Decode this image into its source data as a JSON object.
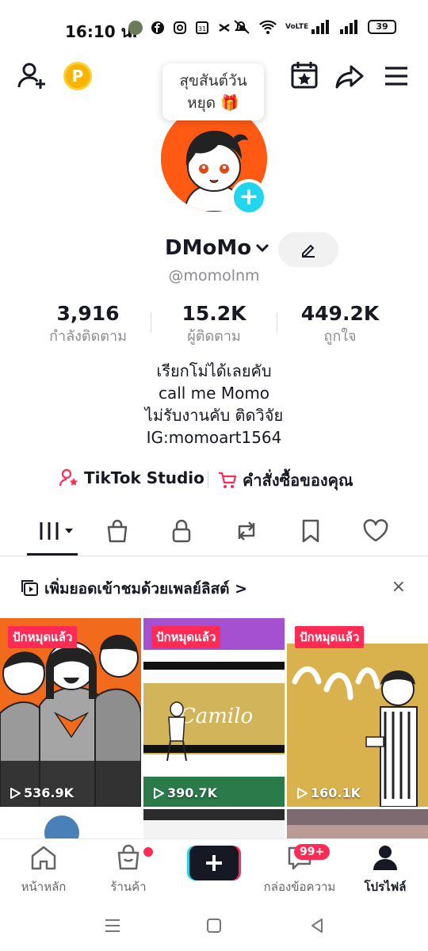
{
  "status_bar": {
    "time": "16:10 น.",
    "network": "VoLTE",
    "battery": "39",
    "battery_level": 0.39
  },
  "topbar": {
    "add_friend_icon": "person-add-icon",
    "coin_label": "P",
    "tooltip_line1": "สุขสันต์วัน",
    "tooltip_line2": "หยุด 🎁",
    "calendar_icon": "calendar-star-icon",
    "share_icon": "share-arrow-icon",
    "menu_icon": "hamburger-menu-icon"
  },
  "profile": {
    "display_name": "DMoMo",
    "username": "@momolnm",
    "stats": [
      {
        "value": "3,916",
        "label": "กำลังติดตาม"
      },
      {
        "value": "15.2K",
        "label": "ผู้ติดตาม"
      },
      {
        "value": "449.2K",
        "label": "ถูกใจ"
      }
    ],
    "bio": [
      "เรียกโม่ได้เลยคับ",
      "call me  Momo",
      "ไม่รับงานคับ ติดวิจัย",
      "IG:momoart1564"
    ]
  },
  "links": {
    "studio": "TikTok Studio",
    "orders": "คำสั่งซื้อของคุณ"
  },
  "tabs": [
    {
      "name": "videos-tab",
      "icon": "grid-icon"
    },
    {
      "name": "shop-tab",
      "icon": "bag-icon"
    },
    {
      "name": "private-tab",
      "icon": "lock-icon"
    },
    {
      "name": "reposts-tab",
      "icon": "repost-icon"
    },
    {
      "name": "favorites-tab",
      "icon": "bookmark-icon"
    },
    {
      "name": "liked-tab",
      "icon": "heart-icon"
    }
  ],
  "playlist_banner": {
    "text": "เพิ่มยอดเข้าชมด้วยเพลย์ลิสต์ >",
    "close": "×"
  },
  "videos": [
    {
      "pinned": "ปักหมุดแล้ว",
      "views": "536.9K"
    },
    {
      "pinned": "ปักหมุดแล้ว",
      "views": "390.7K",
      "title_text": "Camilo"
    },
    {
      "pinned": "ปักหมุดแล้ว",
      "views": "160.1K"
    }
  ],
  "bottom_nav": {
    "home": "หน้าหลัก",
    "shop": "ร้านค้า",
    "inbox": "กล่องข้อความ",
    "inbox_badge": "99+",
    "profile": "โปรไฟล์"
  },
  "colors": {
    "accent_red": "#fe2c55",
    "cyan": "#20d5ec",
    "avatar_bg": "#ff5a14"
  }
}
